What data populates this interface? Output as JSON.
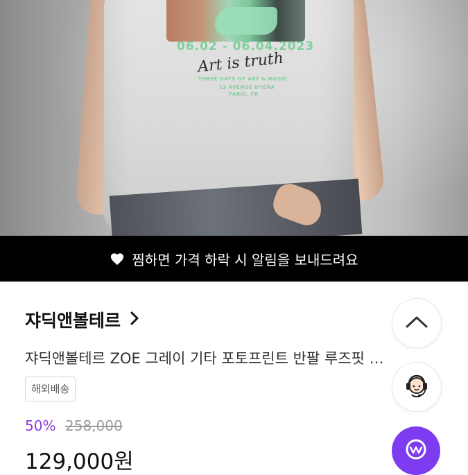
{
  "banner": {
    "text": "찜하면 가격 하락 시 알림을 보내드려요",
    "icon": "heart-icon"
  },
  "shop": {
    "name": "쟈딕앤볼테르",
    "icon": "chevron-right-icon"
  },
  "product": {
    "title": "쟈딕앤볼테르 ZOE 그레이 기타 포토프린트 반팔 루즈핏 …",
    "tag": "해외배송",
    "discount": "50%",
    "original_price": "258,000",
    "price": "129,000원"
  },
  "photo_print": {
    "date": "06.02 - 06.04.2023",
    "script": "Art is truth",
    "line1": "THREE DAYS OF ART & MUSIC",
    "line2": "13 AVENUE D'IENA",
    "line3": "PARIS, FR"
  },
  "fabs": {
    "scroll_top_icon": "chevron-up-icon",
    "support_icon": "headset-agent-icon",
    "app_icon": "brand-w-icon"
  },
  "colors": {
    "accent": "#7d3cf0",
    "discount": "#8e3bd9",
    "banner_bg": "#000000"
  }
}
